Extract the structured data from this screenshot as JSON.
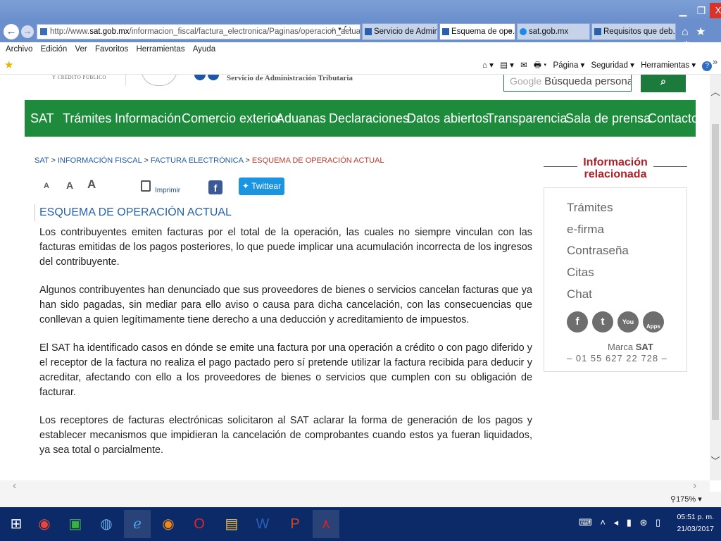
{
  "window": {
    "minimize_glyph": "▁",
    "maximize_glyph": "❐",
    "close_glyph": "X"
  },
  "browser": {
    "back_glyph": "←",
    "forward_glyph": "→",
    "url_prefix": "http://www.",
    "url_domain": "sat.gob.mx",
    "url_path": "/informacion_fiscal/factura_electronica/Paginas/operacion_actual.aspx",
    "url_tools": "⌕ ▾ ↻",
    "tabs": [
      {
        "label": "Servicio de Adminis...",
        "icon": "sat-favicon",
        "active": false
      },
      {
        "label": "Esquema de ope...",
        "icon": "sat-favicon",
        "active": true,
        "close": "×"
      },
      {
        "label": "sat.gob.mx",
        "icon": "ie-favicon",
        "active": false
      },
      {
        "label": "Requisitos que deb...",
        "icon": "sat-favicon",
        "active": false
      }
    ],
    "toolbar_icons": "⌂ ★ ⚙",
    "menu": [
      "Archivo",
      "Edición",
      "Ver",
      "Favoritos",
      "Herramientas",
      "Ayuda"
    ],
    "command_bar": [
      "⌂ ▾",
      "▤ ▾",
      "✉",
      "🖶 ▾",
      "Página ▾",
      "Seguridad ▾",
      "Herramientas ▾"
    ],
    "help_glyph": "?",
    "more_glyph": "»",
    "favorites_star": "★",
    "zoom": "175%",
    "zoom_arrow": "▾"
  },
  "site": {
    "shcp_text": "Y CRÉDITO PÚBLICO",
    "agency_name": "Servicio de Administración Tributaria",
    "search_placeholder_brand": "Google",
    "search_placeholder": "Búsqueda personaliz",
    "search_button_glyph": "⌕",
    "nav": [
      "SAT",
      "Trámites",
      "Información",
      "Comercio exterior",
      "Aduanas",
      "Declaraciones",
      "Datos abiertos",
      "Transparencia",
      "Sala de prensa",
      "Contacto"
    ]
  },
  "breadcrumb": {
    "items": [
      "SAT",
      "INFORMACIÓN FISCAL",
      "FACTURA ELECTRÓNICA"
    ],
    "separator": ">",
    "current": "ESQUEMA DE OPERACIÓN ACTUAL"
  },
  "tools": {
    "print_label": "Imprimir",
    "facebook_glyph": "f",
    "tweet_label": "Twittear"
  },
  "article": {
    "title": "ESQUEMA DE OPERACIÓN ACTUAL",
    "paragraphs": [
      "Los contribuyentes emiten facturas por el total de la operación, las cuales no siempre vinculan con las facturas emitidas  de los pagos posteriores, lo que puede implicar una acumulación incorrecta de los ingresos del contribuyente.",
      "Algunos contribuyentes han denunciado que sus proveedores de bienes o servicios cancelan facturas que ya han sido pagadas, sin mediar para ello aviso o causa para dicha cancelación, con las consecuencias que conllevan a quien legítimamente tiene derecho a una deducción y acreditamiento de impuestos.",
      "El SAT ha identificado casos en dónde se emite una factura por una operación a crédito o con pago diferido y el receptor de la factura no realiza el pago pactado pero sí pretende utilizar la factura recibida para deducir y acreditar, afectando con ello a los proveedores de bienes o servicios que cumplen con su obligación de facturar.",
      "Los receptores de facturas electrónicas solicitaron al SAT aclarar la forma de generación de los pagos y establecer mecanismos que impidieran la cancelación de comprobantes cuando estos ya fueran liquidados, ya sea total o parcialmente."
    ]
  },
  "sidebar": {
    "heading_line1": "Información",
    "heading_line2": "relacionada",
    "links": [
      "Trámites",
      "e-firma",
      "Contraseña",
      "Citas",
      "Chat"
    ],
    "social": [
      "f",
      "t",
      "You",
      "Apps"
    ],
    "marca_label": "Marca",
    "marca_brand": "SAT",
    "phone": "–  01 55 627 22 728  –"
  },
  "taskbar": {
    "start_glyph": "⊞",
    "tray": "⌨ ˄ ◂ ▮ ⊛ ▯",
    "time": "05:51 p. m.",
    "date": "21/03/2017"
  }
}
